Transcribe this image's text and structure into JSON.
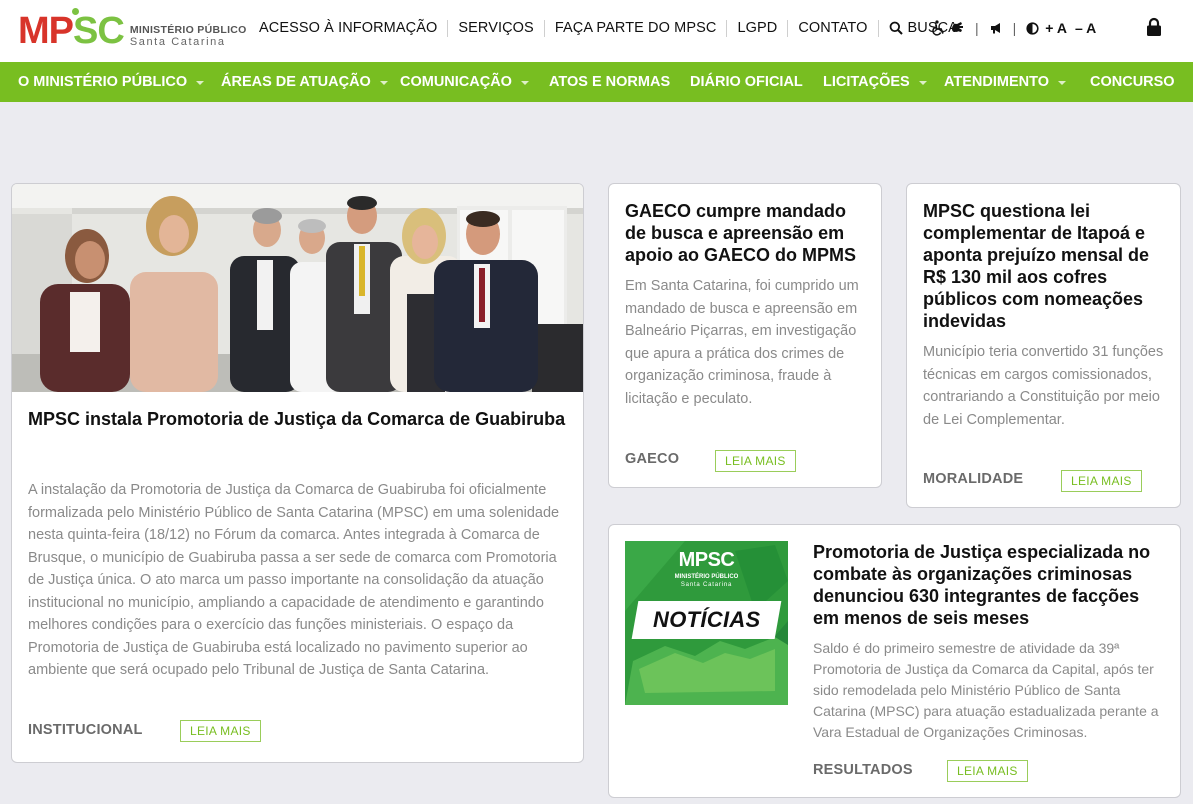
{
  "header": {
    "logo": {
      "mark": "MPSC",
      "line1": "MINISTÉRIO PÚBLICO",
      "line2": "Santa Catarina"
    },
    "nav": [
      {
        "label": "ACESSO À INFORMAÇÃO"
      },
      {
        "label": "SERVIÇOS"
      },
      {
        "label": "FAÇA PARTE DO MPSC"
      },
      {
        "label": "LGPD"
      },
      {
        "label": "CONTATO"
      }
    ],
    "search_label": "BUSCA",
    "font_controls": {
      "plus": "+ A",
      "minus": "– A"
    }
  },
  "mainnav": [
    {
      "label": "O MINISTÉRIO PÚBLICO",
      "dropdown": true
    },
    {
      "label": "ÁREAS DE ATUAÇÃO",
      "dropdown": true
    },
    {
      "label": "COMUNICAÇÃO",
      "dropdown": true
    },
    {
      "label": "ATOS E NORMAS",
      "dropdown": false
    },
    {
      "label": "DIÁRIO OFICIAL",
      "dropdown": false
    },
    {
      "label": "LICITAÇÕES",
      "dropdown": true
    },
    {
      "label": "ATENDIMENTO",
      "dropdown": true
    },
    {
      "label": "CONCURSO",
      "dropdown": false
    }
  ],
  "news": {
    "main": {
      "title": "MPSC instala Promotoria de Justiça da Comarca de Guabiruba",
      "excerpt": "A instalação da Promotoria de Justiça da Comarca de Guabiruba foi oficialmente formalizada pelo Ministério Público de Santa Catarina (MPSC) em uma solenidade nesta quinta-feira (18/12) no Fórum da comarca. Antes integrada à Comarca de Brusque, o município de Guabiruba passa a ser sede de comarca com Promotoria de Justiça única. O ato marca um passo importante na consolidação da atuação institucional no município, ampliando a capacidade de atendimento e garantindo melhores condições para o exercício das funções ministeriais. O espaço da Promotoria de Justiça de Guabiruba está localizado no pavimento superior ao ambiente que será ocupado pelo Tribunal de Justiça de Santa Catarina.",
      "category": "INSTITUCIONAL",
      "read_more": "LEIA MAIS"
    },
    "gaeco": {
      "title": "GAECO cumpre mandado de busca e apreensão em apoio ao GAECO do MPMS",
      "excerpt": "Em Santa Catarina, foi cumprido um mandado de busca e apreensão em Balneário Piçarras, em investigação que apura a prática dos crimes de organização criminosa, fraude à licitação e peculato.",
      "category": "GAECO",
      "read_more": "LEIA MAIS"
    },
    "itapoa": {
      "title": "MPSC questiona lei complementar de Itapoá e aponta prejuízo mensal de R$ 130 mil aos cofres públicos com nomeações indevidas",
      "excerpt": "Município teria convertido 31 funções técnicas em cargos comissionados, contrariando a Constituição por meio de Lei Complementar.",
      "category": "MORALIDADE",
      "read_more": "LEIA MAIS"
    },
    "faccoes": {
      "image_title": "NOTÍCIAS",
      "image_logo": "MPSC",
      "image_logo_line1": "MINISTÉRIO PÚBLICO",
      "image_logo_line2": "Santa Catarina",
      "title": "Promotoria de Justiça especializada no combate às organizações criminosas denunciou 630 integrantes de facções em menos de seis meses",
      "excerpt": "Saldo é do primeiro semestre de atividade da 39ª Promotoria de Justiça da Comarca da Capital, após ter sido remodelada pelo Ministério Público de Santa Catarina (MPSC) para atuação estadualizada perante a Vara Estadual de Organizações Criminosas.",
      "category": "RESULTADOS",
      "read_more": "LEIA MAIS"
    }
  },
  "colors": {
    "green": "#78be21",
    "red": "#d8342a",
    "background": "#ebebf0"
  }
}
